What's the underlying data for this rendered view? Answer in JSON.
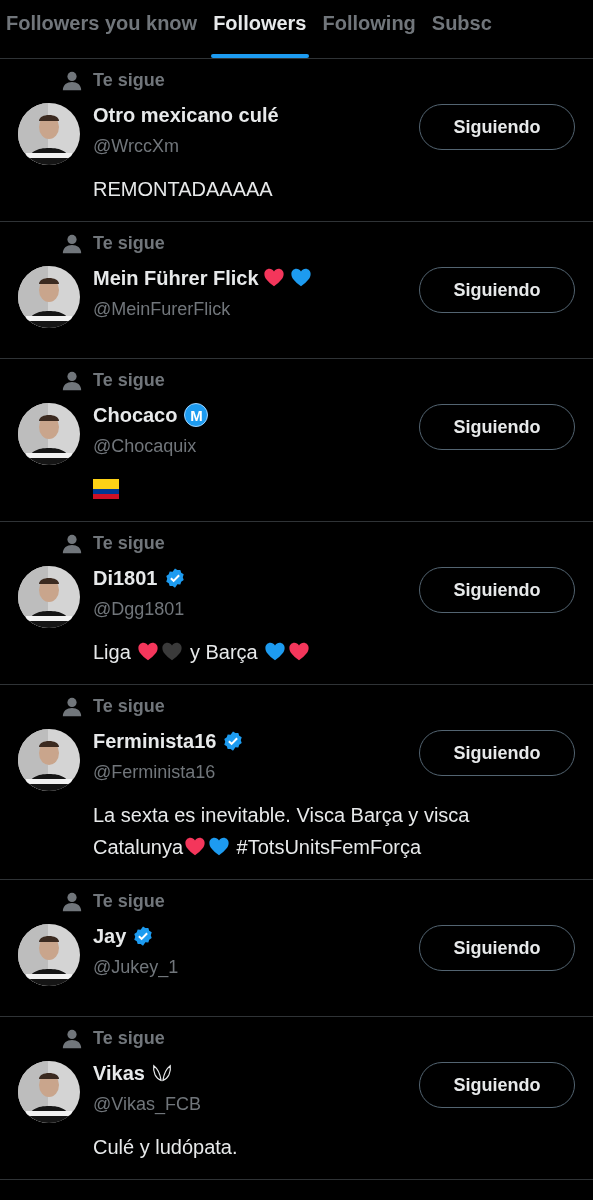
{
  "tabs": [
    {
      "label": "Followers you know",
      "selected": false
    },
    {
      "label": "Followers",
      "selected": true
    },
    {
      "label": "Following",
      "selected": false
    },
    {
      "label": "Subsc",
      "selected": false
    }
  ],
  "users": [
    {
      "follows_you": "Te sigue",
      "name": "Otro mexicano culé",
      "handle": "@WrccXm",
      "button": "Siguiendo",
      "bio": [
        {
          "kind": "text",
          "text": "REMONTADAAAAA"
        }
      ]
    },
    {
      "follows_you": "Te sigue",
      "name": "Mein Führer Flick",
      "name_extras": [
        {
          "kind": "heart",
          "color": "#f4365b"
        },
        {
          "kind": "heart",
          "color": "#1d9bf0"
        }
      ],
      "handle": "@MeinFurerFlick",
      "button": "Siguiendo"
    },
    {
      "follows_you": "Te sigue",
      "name": "Chocaco",
      "name_extras": [
        {
          "kind": "letter-badge",
          "text": "M"
        }
      ],
      "handle": "@Chocaquix",
      "button": "Siguiendo",
      "bio": [
        {
          "kind": "flag"
        }
      ]
    },
    {
      "follows_you": "Te sigue",
      "name": "Di1801",
      "name_extras": [
        {
          "kind": "verified"
        }
      ],
      "handle": "@Dgg1801",
      "button": "Siguiendo",
      "bio": [
        {
          "kind": "text",
          "text": "Liga "
        },
        {
          "kind": "heart",
          "color": "#f4365b"
        },
        {
          "kind": "heart",
          "color": "#3a3a3a"
        },
        {
          "kind": "text",
          "text": " y Barça "
        },
        {
          "kind": "heart",
          "color": "#1d9bf0"
        },
        {
          "kind": "heart",
          "color": "#f4365b"
        }
      ]
    },
    {
      "follows_you": "Te sigue",
      "name": "Ferminista16",
      "name_extras": [
        {
          "kind": "verified"
        }
      ],
      "handle": "@Ferminista16",
      "button": "Siguiendo",
      "bio": [
        {
          "kind": "text",
          "text": "La sexta es inevitable. Visca Barça y visca Catalunya"
        },
        {
          "kind": "heart",
          "color": "#f4365b"
        },
        {
          "kind": "heart",
          "color": "#1d9bf0"
        },
        {
          "kind": "text",
          "text": " #TotsUnitsFemForça"
        }
      ]
    },
    {
      "follows_you": "Te sigue",
      "name": "Jay",
      "name_extras": [
        {
          "kind": "verified"
        }
      ],
      "handle": "@Jukey_1",
      "button": "Siguiendo"
    },
    {
      "follows_you": "Te sigue",
      "name": "Vikas",
      "name_extras": [
        {
          "kind": "wings"
        }
      ],
      "handle": "@Vikas_FCB",
      "button": "Siguiendo",
      "bio": [
        {
          "kind": "text",
          "text": "Culé y ludópata."
        }
      ]
    }
  ]
}
